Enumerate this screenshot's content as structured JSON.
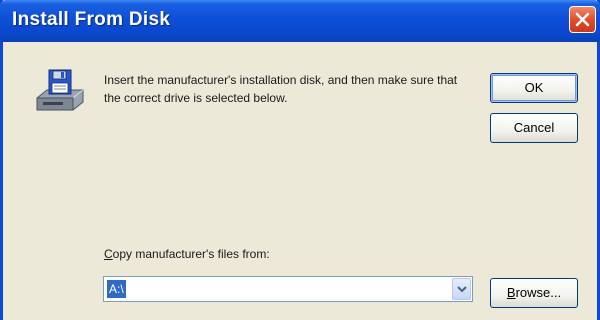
{
  "window": {
    "title": "Install From Disk"
  },
  "dialog": {
    "message": "Insert the manufacturer's installation disk, and then make sure that the correct drive is selected below.",
    "ok_label": "OK",
    "cancel_label": "Cancel",
    "path_label_accel": "C",
    "path_label_rest": "opy manufacturer's files from:",
    "path_value": "A:\\",
    "browse_accel": "B",
    "browse_rest": "rowse..."
  },
  "icons": {
    "close": "close-icon",
    "disk": "floppy-disk-drive-icon",
    "dropdown": "chevron-down-icon"
  },
  "colors": {
    "titlebar": "#0a48cc",
    "dialog_bg": "#ece9d8",
    "close_button": "#e0502c",
    "selection": "#316ac5"
  }
}
